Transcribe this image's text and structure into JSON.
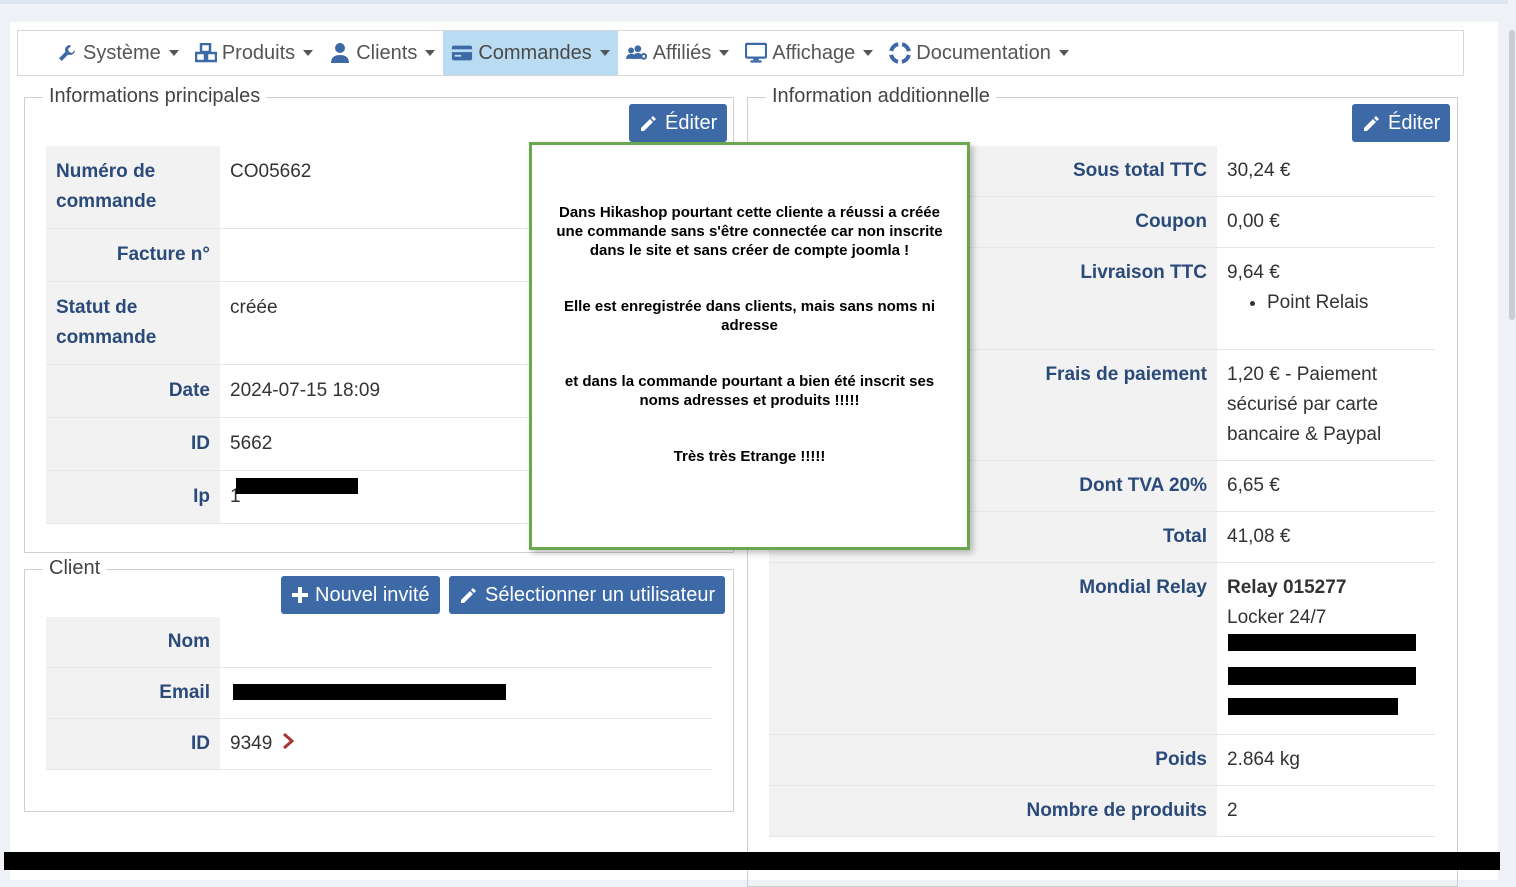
{
  "nav": [
    {
      "label": "Système",
      "icon": "wrench-icon",
      "active": false
    },
    {
      "label": "Produits",
      "icon": "cubes-icon",
      "active": false
    },
    {
      "label": "Clients",
      "icon": "user-icon",
      "active": false
    },
    {
      "label": "Commandes",
      "icon": "credit-card-icon",
      "active": true
    },
    {
      "label": "Affiliés",
      "icon": "users-cog-icon",
      "active": false
    },
    {
      "label": "Affichage",
      "icon": "monitor-icon",
      "active": false
    },
    {
      "label": "Documentation",
      "icon": "lifebuoy-icon",
      "active": false
    }
  ],
  "main_info": {
    "legend": "Informations principales",
    "edit_label": "Éditer",
    "rows": [
      {
        "label": "Numéro de commande",
        "value": "CO05662"
      },
      {
        "label": "Facture n°",
        "value": ""
      },
      {
        "label": "Statut de commande",
        "value": "créée"
      },
      {
        "label": "Date",
        "value": "2024-07-15 18:09"
      },
      {
        "label": "ID",
        "value": "5662"
      },
      {
        "label": "Ip",
        "value": "1"
      }
    ]
  },
  "client": {
    "legend": "Client",
    "new_guest_label": "Nouvel invité",
    "select_user_label": "Sélectionner un utilisateur",
    "rows": [
      {
        "label": "Nom",
        "value": ""
      },
      {
        "label": "Email",
        "value": ""
      },
      {
        "label": "ID",
        "value": "9349"
      }
    ]
  },
  "additional": {
    "legend": "Information additionnelle",
    "edit_label": "Éditer",
    "rows": [
      {
        "label": "Sous total TTC",
        "value": "30,24 €"
      },
      {
        "label": "Coupon",
        "value": "0,00 €"
      },
      {
        "label": "Livraison TTC",
        "value": "9,64 €",
        "bullet": "Point Relais"
      },
      {
        "label": "Frais de paiement",
        "value": "1,20 € - Paiement sécurisé par carte bancaire & Paypal"
      },
      {
        "label": "Dont TVA 20%",
        "value": "6,65 €"
      },
      {
        "label": "Total",
        "value": "41,08 €"
      },
      {
        "label": "Mondial Relay",
        "value_bold": "Relay 015277",
        "value": "Locker 24/7"
      },
      {
        "label": "Poids",
        "value": "2.864 kg"
      },
      {
        "label": "Nombre de produits",
        "value": "2"
      }
    ]
  },
  "note": {
    "paragraphs": [
      "Dans Hikashop pourtant cette cliente a réussi a créée une commande sans s'être connectée car non inscrite dans le site et sans créer de compte joomla !",
      "Elle est enregistrée dans clients, mais sans noms ni adresse",
      "et dans la commande pourtant a bien été inscrit ses noms adresses et produits !!!!!",
      "Très très Etrange !!!!!"
    ]
  },
  "colors": {
    "accent": "#3d6aa6",
    "nav_active": "#b9dcf3",
    "label": "#2a4a7a",
    "note_border": "#6aa84f"
  }
}
